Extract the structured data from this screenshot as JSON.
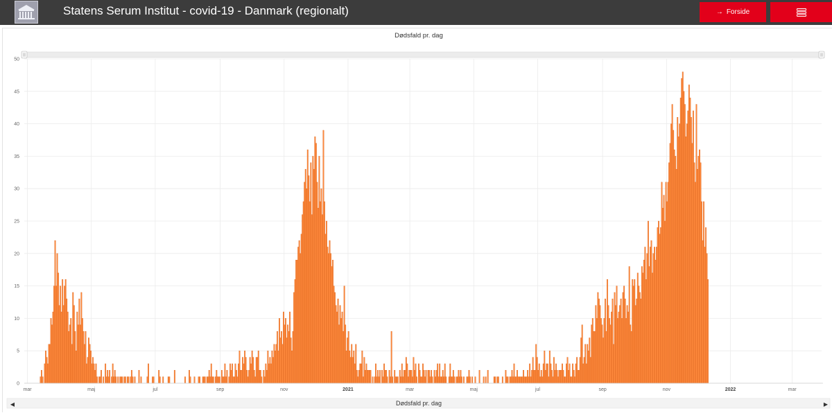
{
  "header": {
    "title": "Statens Serum Institut - covid-19 - Danmark (regionalt)",
    "forside_label": "Forside",
    "logo_icon": "ssi-building-logo",
    "menu_icon": "stacked-menu-icon"
  },
  "colors": {
    "bar_fill": "#ff8a3d",
    "bar_stroke": "#d9621a",
    "accent": "#e2001a",
    "header_bg": "#3c3c3c"
  },
  "chart_data": {
    "type": "bar",
    "title": "Dødsfald pr. dag",
    "xlabel": "Dødsfald pr. dag",
    "ylabel": "",
    "ylim": [
      0,
      50
    ],
    "yticks": [
      0,
      5,
      10,
      15,
      20,
      25,
      30,
      35,
      40,
      45,
      50
    ],
    "xlim": [
      "2020-02-27",
      "2022-03-29"
    ],
    "xticks": [
      {
        "date": "2020-03-01",
        "label": "mar"
      },
      {
        "date": "2020-05-01",
        "label": "maj"
      },
      {
        "date": "2020-07-01",
        "label": "jul"
      },
      {
        "date": "2020-09-01",
        "label": "sep"
      },
      {
        "date": "2020-11-01",
        "label": "nov"
      },
      {
        "date": "2021-01-01",
        "label": "2021",
        "year": true
      },
      {
        "date": "2021-03-01",
        "label": "mar"
      },
      {
        "date": "2021-05-01",
        "label": "maj"
      },
      {
        "date": "2021-07-01",
        "label": "jul"
      },
      {
        "date": "2021-09-01",
        "label": "sep"
      },
      {
        "date": "2021-11-01",
        "label": "nov"
      },
      {
        "date": "2022-01-01",
        "label": "2022",
        "year": true
      },
      {
        "date": "2022-03-01",
        "label": "mar"
      }
    ],
    "grid": true,
    "start_date": "2020-03-11",
    "values": [
      0,
      0,
      1,
      2,
      1,
      0,
      3,
      5,
      4,
      3,
      6,
      6,
      10,
      9,
      11,
      15,
      22,
      15,
      20,
      17,
      12,
      15,
      11,
      16,
      12,
      15,
      16,
      13,
      11,
      8,
      9,
      10,
      6,
      14,
      12,
      8,
      5,
      11,
      9,
      13,
      9,
      14,
      10,
      8,
      6,
      8,
      3,
      4,
      7,
      6,
      5,
      3,
      4,
      3,
      2,
      3,
      1,
      0,
      1,
      1,
      2,
      0,
      1,
      0,
      3,
      1,
      2,
      1,
      2,
      0,
      1,
      3,
      1,
      2,
      1,
      0,
      1,
      0,
      1,
      1,
      1,
      0,
      1,
      1,
      0,
      1,
      1,
      0,
      1,
      2,
      1,
      0,
      1,
      0,
      0,
      0,
      2,
      0,
      1,
      0,
      0,
      0,
      0,
      0,
      1,
      3,
      0,
      0,
      0,
      1,
      1,
      0,
      0,
      0,
      0,
      2,
      1,
      0,
      0,
      1,
      0,
      0,
      0,
      0,
      1,
      1,
      0,
      0,
      0,
      0,
      2,
      0,
      0,
      0,
      0,
      0,
      0,
      0,
      0,
      0,
      1,
      0,
      0,
      0,
      2,
      1,
      0,
      0,
      0,
      1,
      0,
      0,
      0,
      1,
      1,
      0,
      0,
      1,
      1,
      1,
      0,
      1,
      1,
      2,
      1,
      3,
      1,
      1,
      0,
      1,
      2,
      1,
      1,
      1,
      0,
      2,
      1,
      1,
      3,
      1,
      2,
      0,
      1,
      3,
      2,
      3,
      1,
      1,
      3,
      2,
      1,
      3,
      5,
      2,
      2,
      4,
      3,
      5,
      4,
      2,
      1,
      2,
      4,
      3,
      5,
      4,
      2,
      1,
      4,
      4,
      5,
      2,
      2,
      1,
      0,
      2,
      1,
      3,
      2,
      5,
      3,
      4,
      3,
      5,
      4,
      6,
      5,
      6,
      8,
      5,
      10,
      7,
      8,
      6,
      11,
      9,
      10,
      7,
      9,
      8,
      11,
      7,
      5,
      8,
      14,
      16,
      19,
      19,
      21,
      22,
      20,
      23,
      26,
      28,
      31,
      33,
      30,
      36,
      32,
      28,
      34,
      26,
      35,
      33,
      38,
      37,
      31,
      27,
      35,
      28,
      30,
      26,
      39,
      28,
      23,
      25,
      21,
      20,
      22,
      20,
      18,
      19,
      15,
      14,
      12,
      11,
      13,
      9,
      12,
      10,
      11,
      8,
      15,
      9,
      5,
      7,
      8,
      5,
      4,
      6,
      4,
      5,
      3,
      6,
      2,
      1,
      2,
      3,
      3,
      5,
      1,
      4,
      2,
      3,
      2,
      2,
      2,
      2,
      0,
      1,
      0,
      1,
      3,
      1,
      2,
      1,
      2,
      0,
      2,
      1,
      3,
      2,
      2,
      1,
      0,
      2,
      1,
      8,
      1,
      0,
      2,
      1,
      1,
      1,
      0,
      2,
      1,
      3,
      1,
      2,
      2,
      4,
      3,
      1,
      2,
      2,
      2,
      1,
      4,
      2,
      3,
      1,
      0,
      3,
      2,
      1,
      1,
      3,
      2,
      1,
      2,
      0,
      2,
      2,
      1,
      2,
      1,
      0,
      2,
      1,
      2,
      3,
      1,
      3,
      1,
      1,
      2,
      1,
      3,
      1,
      0,
      0,
      1,
      3,
      1,
      1,
      2,
      1,
      0,
      1,
      1,
      2,
      1,
      2,
      1,
      0,
      1,
      0,
      0,
      1,
      1,
      2,
      1,
      0,
      1,
      0,
      0,
      1,
      0,
      0,
      0,
      2,
      0,
      0,
      0,
      1,
      0,
      1,
      0,
      2,
      0,
      0,
      0,
      0,
      0,
      1,
      1,
      0,
      1,
      1,
      0,
      0,
      0,
      1,
      0,
      0,
      2,
      1,
      1,
      0,
      1,
      1,
      2,
      1,
      3,
      1,
      1,
      2,
      1,
      1,
      1,
      1,
      1,
      2,
      1,
      1,
      1,
      2,
      1,
      3,
      1,
      2,
      4,
      2,
      2,
      6,
      4,
      2,
      3,
      1,
      2,
      1,
      3,
      5,
      2,
      3,
      3,
      1,
      5,
      3,
      2,
      1,
      4,
      2,
      3,
      2,
      1,
      2,
      2,
      2,
      3,
      2,
      1,
      1,
      3,
      4,
      2,
      3,
      1,
      1,
      3,
      2,
      1,
      3,
      4,
      2,
      2,
      4,
      7,
      9,
      3,
      4,
      6,
      3,
      6,
      5,
      7,
      4,
      9,
      10,
      8,
      8,
      12,
      10,
      14,
      13,
      12,
      10,
      9,
      7,
      10,
      13,
      8,
      16,
      12,
      10,
      9,
      11,
      13,
      6,
      14,
      12,
      15,
      10,
      11,
      12,
      13,
      10,
      14,
      15,
      13,
      10,
      12,
      11,
      18,
      9,
      8,
      16,
      15,
      16,
      12,
      13,
      17,
      15,
      14,
      13,
      18,
      17,
      19,
      21,
      16,
      20,
      25,
      18,
      21,
      22,
      17,
      20,
      21,
      19,
      21,
      24,
      25,
      23,
      24,
      31,
      27,
      29,
      25,
      31,
      28,
      31,
      34,
      37,
      40,
      43,
      39,
      36,
      35,
      33,
      41,
      38,
      40,
      44,
      47,
      48,
      45,
      43,
      38,
      40,
      42,
      46,
      44,
      41,
      37,
      42,
      34,
      31,
      43,
      33,
      35,
      36,
      34,
      28,
      22,
      28,
      21,
      24,
      20,
      16
    ]
  }
}
